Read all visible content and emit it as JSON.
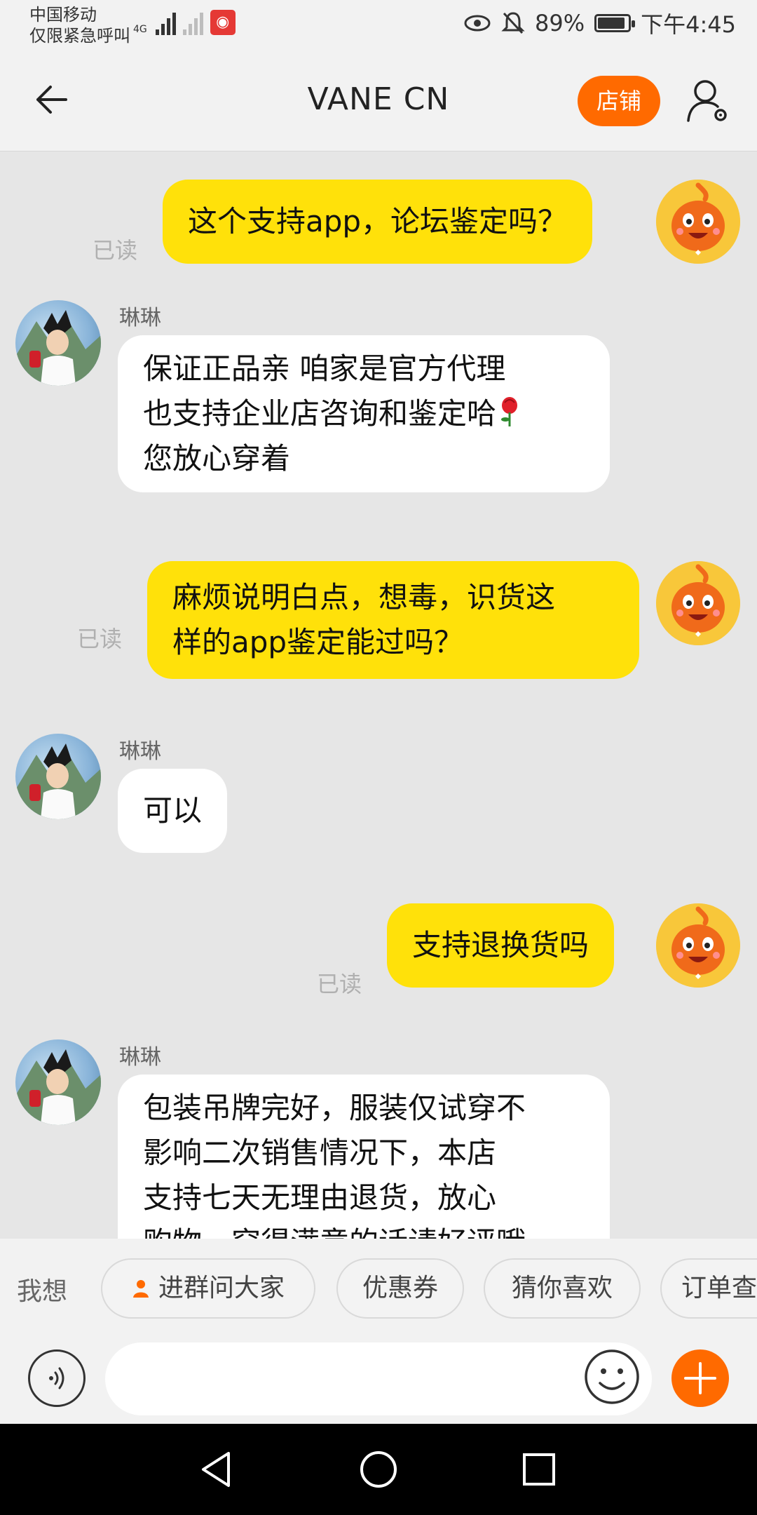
{
  "status_bar": {
    "carrier_line1": "中国移动",
    "carrier_line2": "仅限紧急呼叫",
    "signal_label": "4G",
    "battery_level_percent": 89,
    "battery_text": "89%",
    "time": "下午4:45"
  },
  "header": {
    "title": "VANE CN",
    "shop_button": "店铺"
  },
  "messages": [
    {
      "from": "me",
      "text": "这个支持app，论坛鉴定吗？",
      "status": "已读"
    },
    {
      "from": "them",
      "sender": "琳琳",
      "text_lines": [
        "保证正品亲 咱家是官方代理",
        "也支持企业店咨询和鉴定哈",
        "您放心穿着"
      ],
      "emoji": "rose"
    },
    {
      "from": "me",
      "text_lines": [
        "麻烦说明白点，想毒，识货这",
        "样的app鉴定能过吗？"
      ],
      "status": "已读"
    },
    {
      "from": "them",
      "sender": "琳琳",
      "text": "可以"
    },
    {
      "from": "me",
      "text": "支持退换货吗",
      "status": "已读"
    },
    {
      "from": "them",
      "sender": "琳琳",
      "text_lines": [
        "包装吊牌完好，服装仅试穿不",
        "影响二次销售情况下，本店",
        "支持七天无理由退货，放心",
        "购物，穿得满意的话请好评哦"
      ]
    }
  ],
  "quick_replies": {
    "label": "我想",
    "chips": [
      "进群问大家",
      "优惠券",
      "猜你喜欢",
      "订单查询"
    ]
  },
  "input": {
    "placeholder": ""
  },
  "colors": {
    "accent": "#ff6a00",
    "my_bubble": "#ffe10a",
    "their_bubble": "#ffffff",
    "background": "#e6e6e6"
  },
  "icons": {
    "back": "back-arrow-icon",
    "user_settings": "user-settings-icon",
    "voice": "voice-icon",
    "emoji": "emoji-icon",
    "plus": "plus-icon",
    "nav_back": "nav-back-icon",
    "nav_home": "nav-home-icon",
    "nav_recents": "nav-recents-icon"
  }
}
